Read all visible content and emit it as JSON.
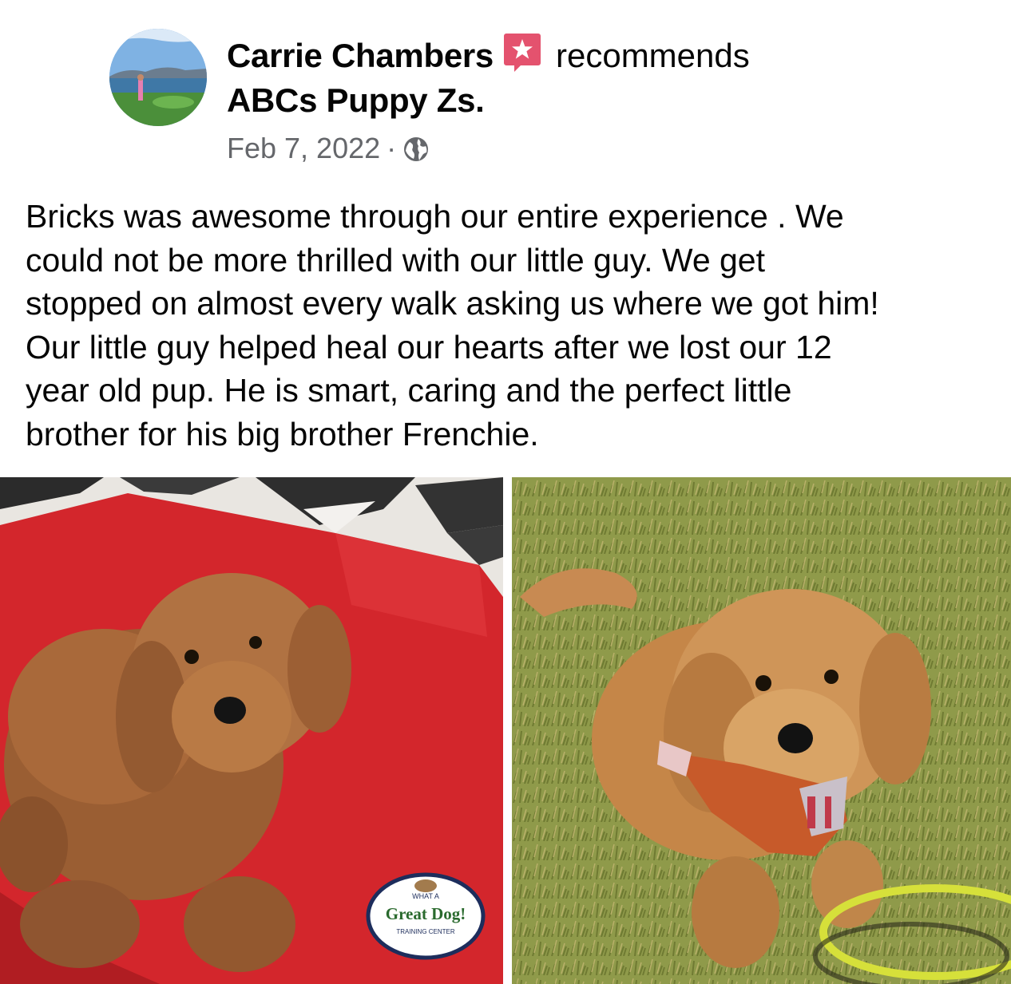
{
  "post": {
    "author": "Carrie Chambers",
    "action": "recommends",
    "page": "ABCs Puppy Zs.",
    "date": "Feb 7, 2022",
    "separator": "·",
    "privacy_icon": "globe-icon",
    "badge_icon": "star-speech-bubble-icon",
    "text": "Bricks  was awesome through our entire experience . We\ncould not be more thrilled with our little guy. We get\nstopped on almost every walk asking us where we got him!\nOur little guy helped heal our hearts after we lost our 12\nyear old pup. He is smart, caring and the perfect little\nbrother for his big brother Frenchie."
  },
  "photos": [
    {
      "patch": {
        "top": "WHAT A",
        "main": "Great Dog!",
        "bottom": "TRAINING CENTER"
      }
    },
    {}
  ],
  "colors": {
    "badge": "#e4526e",
    "secondary_text": "#65676b",
    "mat_red": "#d3262c",
    "grass": "#8f9a4a",
    "puppy": "#b97a3f"
  }
}
